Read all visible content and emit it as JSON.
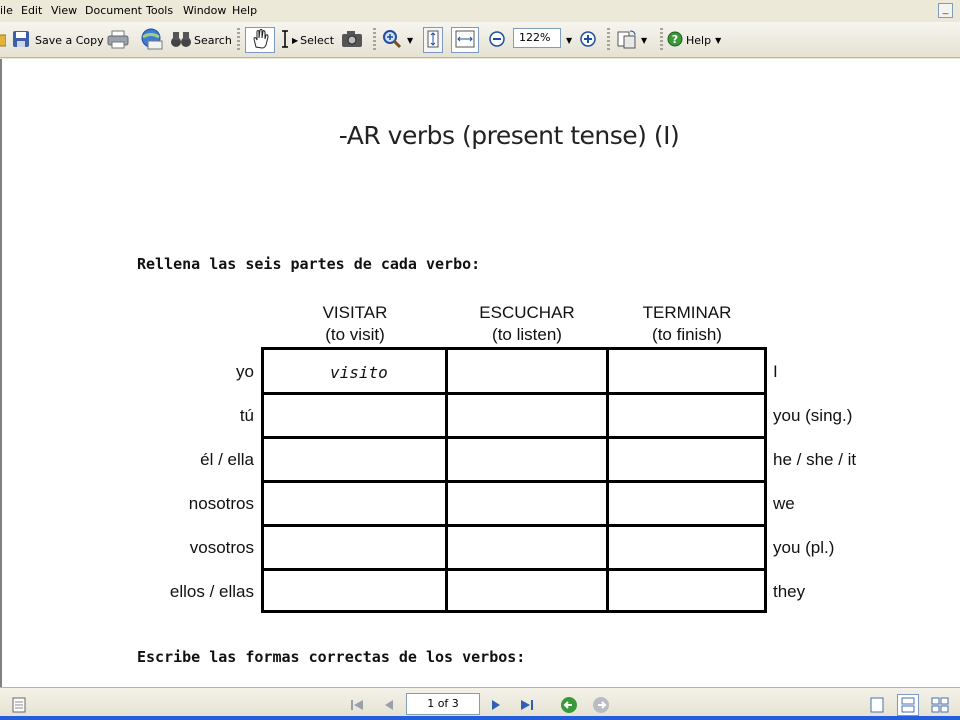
{
  "menu": {
    "items": [
      "ile",
      "Edit",
      "View",
      "Document",
      "Tools",
      "Window",
      "Help"
    ],
    "minimize": "_",
    "close": "✕"
  },
  "toolbar": {
    "save_copy_label": "Save a Copy",
    "search_label": "Search",
    "select_label": "Select",
    "zoom_value": "122%",
    "help_label": "Help"
  },
  "document": {
    "title": "-AR verbs (present tense) (I)",
    "instruction_1": "Rellena las seis partes de cada verbo:",
    "instruction_2": "Escribe las formas correctas de los verbos:",
    "columns": [
      {
        "verb": "VISITAR",
        "meaning": "(to visit)"
      },
      {
        "verb": "ESCUCHAR",
        "meaning": "(to listen)"
      },
      {
        "verb": "TERMINAR",
        "meaning": "(to finish)"
      }
    ],
    "rows": [
      {
        "pronoun": "yo",
        "english": "I"
      },
      {
        "pronoun": "tú",
        "english": "you (sing.)"
      },
      {
        "pronoun": "él / ella",
        "english": "he / she / it"
      },
      {
        "pronoun": "nosotros",
        "english": "we"
      },
      {
        "pronoun": "vosotros",
        "english": "you (pl.)"
      },
      {
        "pronoun": "ellos / ellas",
        "english": "they"
      }
    ],
    "example_answer": "visito"
  },
  "status": {
    "page_indicator": "1 of 3"
  },
  "colors": {
    "toolbar_bg": "#ece9d8",
    "accent_blue": "#245edb",
    "go_green": "#3a9a3a"
  }
}
